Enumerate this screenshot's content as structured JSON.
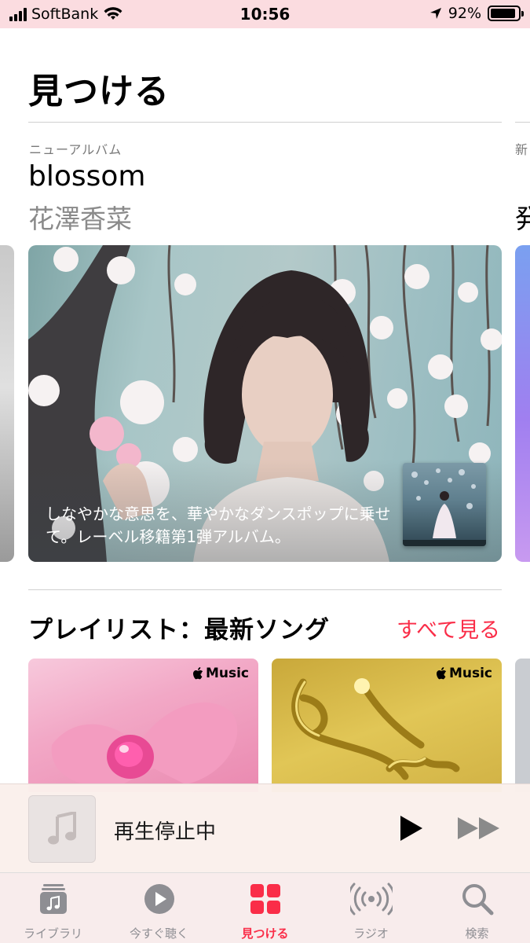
{
  "status_bar": {
    "carrier": "SoftBank",
    "time": "10:56",
    "battery_percent": "92%",
    "battery_level": 0.92
  },
  "page": {
    "title": "見つける"
  },
  "featured": {
    "kicker": "ニューアルバム",
    "title": "blossom",
    "artist": "花澤香菜",
    "description": "しなやかな意思を、華やかなダンスポップに乗せて。レーベル移籍第1弾アルバム。",
    "next_kicker_partial": "新",
    "next_title_partial": "発"
  },
  "playlists": {
    "section_title": "プレイリスト：最新ソング",
    "see_all": "すべて見る",
    "cards": [
      {
        "badge": "Music"
      },
      {
        "badge": "Music"
      }
    ]
  },
  "mini_player": {
    "title": "再生停止中",
    "icons": [
      "music-note-icon",
      "play-icon",
      "fast-forward-icon"
    ]
  },
  "tab_bar": {
    "active": "見つける",
    "tabs": [
      {
        "label": "ライブラリ",
        "icon": "library-icon"
      },
      {
        "label": "今すぐ聴く",
        "icon": "listen-now-icon"
      },
      {
        "label": "見つける",
        "icon": "browse-grid-icon"
      },
      {
        "label": "ラジオ",
        "icon": "radio-icon"
      },
      {
        "label": "検索",
        "icon": "search-icon"
      }
    ]
  },
  "colors": {
    "accent": "#fa2d48",
    "status_bar_bg": "#fbdce0",
    "inactive_tab": "#8e8e93"
  }
}
